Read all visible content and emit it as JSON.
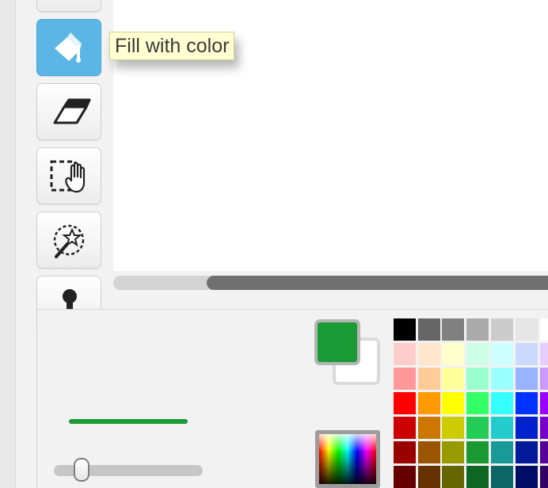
{
  "tooltip": {
    "text": "Fill with color"
  },
  "toolbar": {
    "tools": [
      {
        "name": "tool-above-hidden",
        "active": false
      },
      {
        "name": "fill-tool",
        "icon": "paint-bucket-icon",
        "active": true
      },
      {
        "name": "eraser-tool",
        "icon": "eraser-icon",
        "active": false
      },
      {
        "name": "select-tool",
        "icon": "select-hand-icon",
        "active": false
      },
      {
        "name": "magic-select-tool",
        "icon": "magic-wand-select-icon",
        "active": false
      },
      {
        "name": "stamp-tool",
        "icon": "stamp-icon",
        "active": false
      }
    ]
  },
  "colors": {
    "foreground": "#1a9b35",
    "background": "#ffffff",
    "accent_active_tool": "#5bb5e5"
  },
  "stroke": {
    "preview_color": "#1a9b35",
    "width_level": 0.15
  },
  "palette": {
    "rows": [
      [
        "#000000",
        "#666666",
        "#808080",
        "#aaaaaa",
        "#cccccc",
        "#e5e5e5",
        "#ffffff"
      ],
      [
        "#ffcccc",
        "#ffe6cc",
        "#ffffcc",
        "#ccffe6",
        "#ccffff",
        "#ccd9ff",
        "#e6ccff"
      ],
      [
        "#ff9999",
        "#ffcc99",
        "#ffff99",
        "#99ffcc",
        "#99ffff",
        "#99b3ff",
        "#cc99ff"
      ],
      [
        "#ff0000",
        "#ff9900",
        "#ffff00",
        "#33ff66",
        "#33ffff",
        "#0033ff",
        "#9900ff"
      ],
      [
        "#cc0000",
        "#cc7700",
        "#cccc00",
        "#22cc55",
        "#22cccc",
        "#0022cc",
        "#7700cc"
      ],
      [
        "#990000",
        "#995500",
        "#999900",
        "#1a9933",
        "#1a9999",
        "#001a99",
        "#550099"
      ],
      [
        "#660000",
        "#663300",
        "#666600",
        "#0d6622",
        "#0d6666",
        "#000d66",
        "#330066"
      ]
    ]
  }
}
